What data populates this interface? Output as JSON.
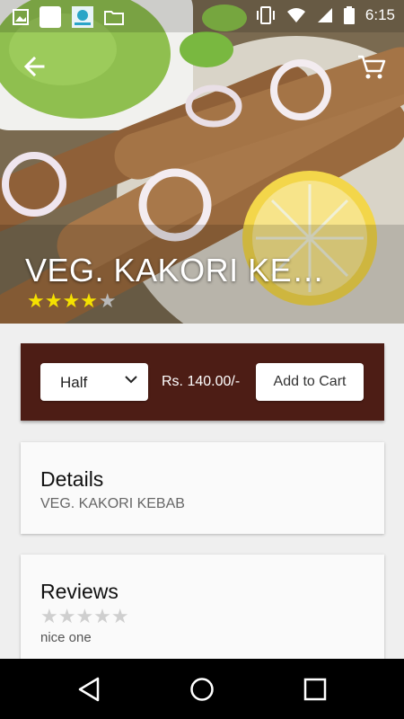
{
  "status_bar": {
    "time": "6:15",
    "icons": [
      "image-icon",
      "app-icon",
      "sbi-icon",
      "folder-icon",
      "vibrate-icon",
      "wifi-icon",
      "signal-icon",
      "battery-icon"
    ]
  },
  "header": {
    "back_icon": "arrow-back-icon",
    "cart_icon": "cart-icon"
  },
  "product": {
    "title": "VEG. KAKORI KE…",
    "rating": 4,
    "rating_max": 5,
    "star_filled": "★★★★",
    "star_empty": "★"
  },
  "order": {
    "portion": "Half",
    "price": "Rs. 140.00/-",
    "add_to_cart": "Add to Cart"
  },
  "details": {
    "heading": "Details",
    "description": "VEG. KAKORI KEBAB"
  },
  "reviews": {
    "heading": "Reviews",
    "stars": "★★★★★",
    "rating": 0,
    "comment": "nice one"
  },
  "colors": {
    "accent_bar": "#4d1d15",
    "star": "#f5e100"
  }
}
